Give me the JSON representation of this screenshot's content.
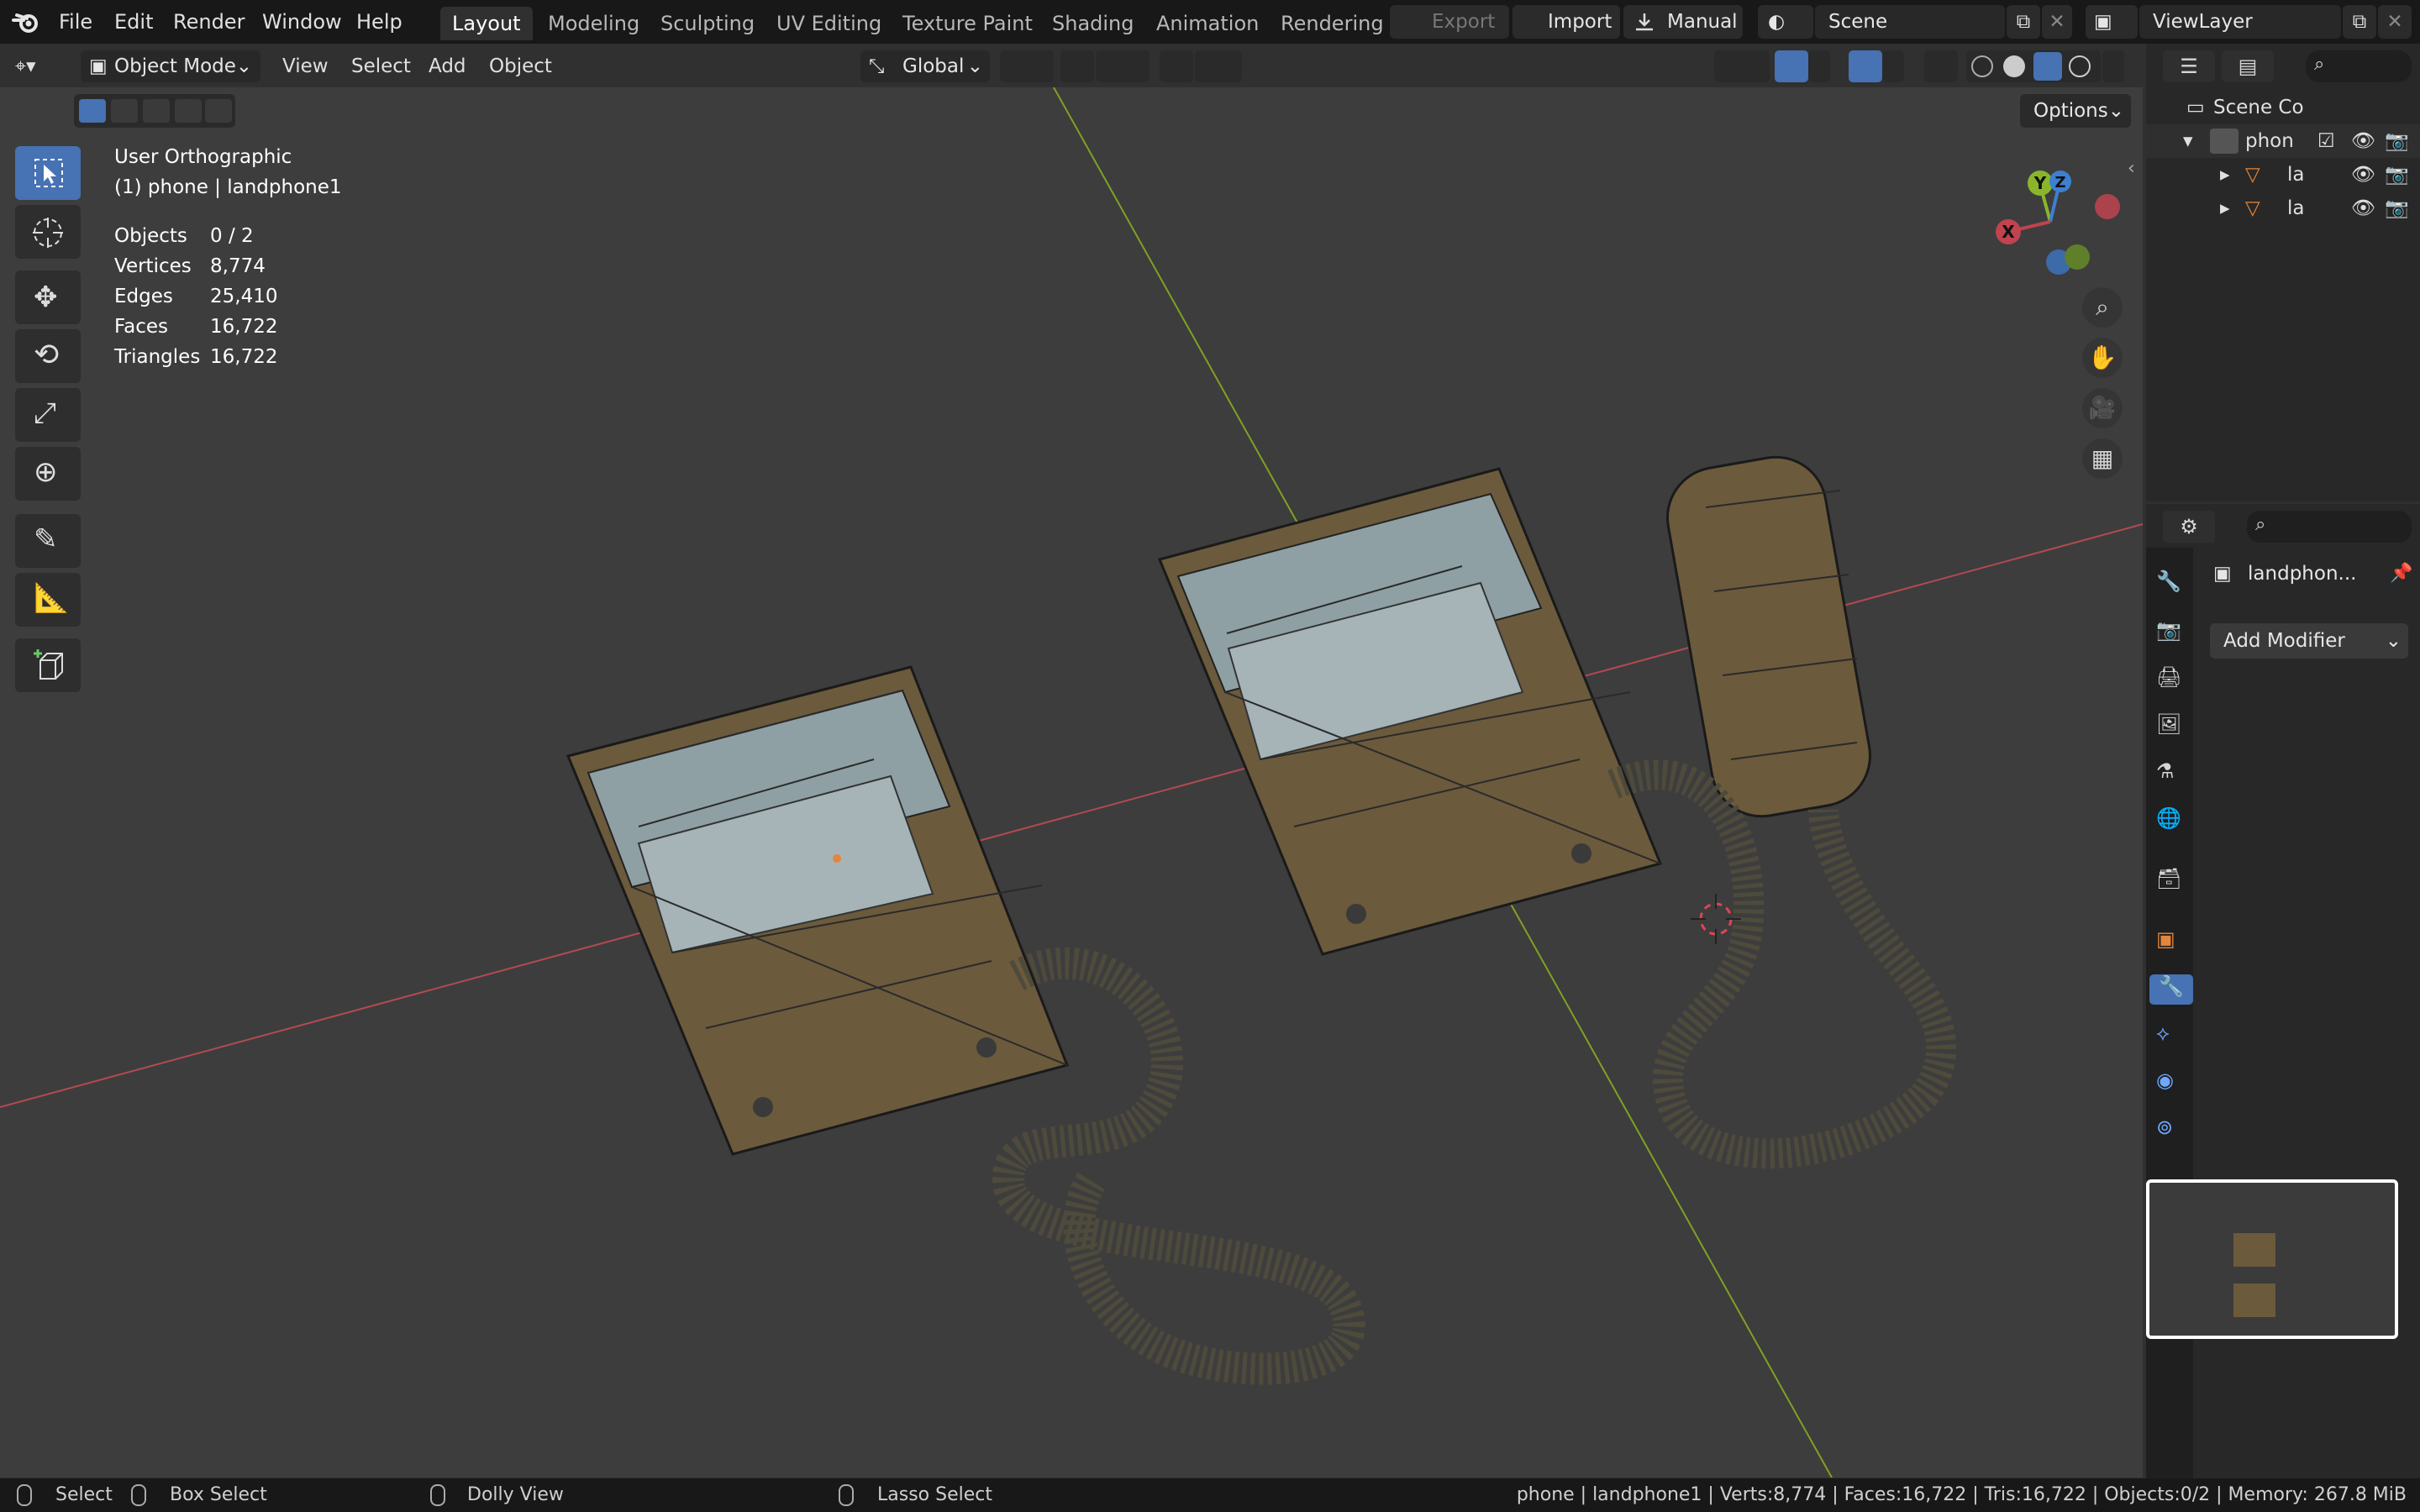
{
  "menu": {
    "items": [
      "File",
      "Edit",
      "Render",
      "Window",
      "Help"
    ]
  },
  "workspaces": {
    "tabs": [
      "Layout",
      "Modeling",
      "Sculpting",
      "UV Editing",
      "Texture Paint",
      "Shading",
      "Animation",
      "Rendering"
    ],
    "active": "Layout"
  },
  "topright": {
    "export_label": "Export",
    "import_label": "Import",
    "manual_label": "Manual",
    "scene_name": "Scene",
    "viewlayer_name": "ViewLayer"
  },
  "viewport_header": {
    "mode": "Object Mode",
    "menus": [
      "View",
      "Select",
      "Add",
      "Object"
    ],
    "orientation": "Global",
    "options_label": "Options"
  },
  "overlay_info": {
    "view_name": "User Orthographic",
    "context": "(1) phone | landphone1",
    "stats": [
      {
        "label": "Objects",
        "value": "0 / 2"
      },
      {
        "label": "Vertices",
        "value": "8,774"
      },
      {
        "label": "Edges",
        "value": "25,410"
      },
      {
        "label": "Faces",
        "value": "16,722"
      },
      {
        "label": "Triangles",
        "value": "16,722"
      }
    ]
  },
  "gizmo": {
    "x": "X",
    "y": "Y",
    "z": "Z"
  },
  "outliner": {
    "root": "Scene Co",
    "collection": "phone",
    "items": [
      "la",
      "la"
    ]
  },
  "properties": {
    "object_name": "landphon...",
    "add_modifier_label": "Add Modifier"
  },
  "statusbar": {
    "select": "Select",
    "box_select": "Box Select",
    "dolly_view": "Dolly View",
    "lasso_select": "Lasso Select",
    "info": "phone | landphone1 | Verts:8,774 | Faces:16,722 | Tris:16,722 | Objects:0/2 | Memory: 267.8 MiB"
  },
  "colors": {
    "accent": "#4772b3",
    "x_axis": "#c0434f",
    "y_axis": "#8ab52b",
    "z_axis": "#3d7fd1",
    "object": "#e3853b"
  }
}
